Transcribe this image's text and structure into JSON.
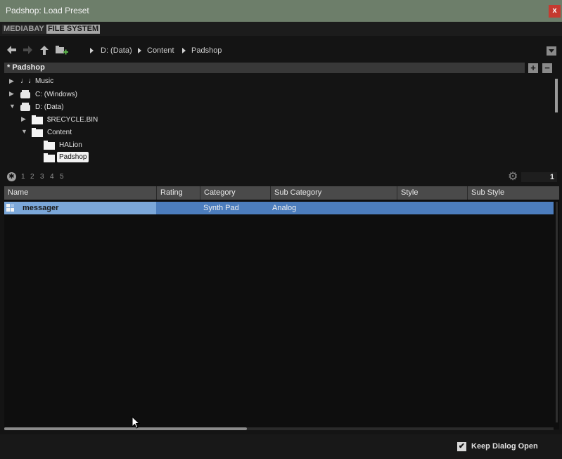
{
  "window": {
    "title": "Padshop: Load Preset",
    "close_label": "x"
  },
  "tabs": [
    {
      "label": "MEDIABAY",
      "active": false
    },
    {
      "label": "FILE SYSTEM",
      "active": true
    }
  ],
  "nav": {
    "back_icon": "arrow-left-icon",
    "forward_icon": "arrow-right-icon",
    "up_icon": "arrow-up-icon",
    "new_folder_icon": "new-folder-icon",
    "breadcrumbs": [
      "D: (Data)",
      "Content",
      "Padshop"
    ]
  },
  "favorites": {
    "label": "Padshop",
    "star": "*",
    "add_label": "+",
    "remove_label": "−"
  },
  "tree": [
    {
      "label": "Music",
      "expanded": false,
      "icon": "music-icon"
    },
    {
      "label": "C: (Windows)",
      "expanded": false,
      "icon": "drive-icon"
    },
    {
      "label": "D: (Data)",
      "expanded": true,
      "icon": "drive-icon"
    },
    {
      "label": "$RECYCLE.BIN",
      "expanded": false,
      "icon": "folder-icon"
    },
    {
      "label": "Content",
      "expanded": true,
      "icon": "folder-icon"
    },
    {
      "label": "HALion",
      "expanded": false,
      "icon": "folder-icon"
    },
    {
      "label": "Padshop",
      "expanded": false,
      "icon": "folder-icon",
      "selected": true
    }
  ],
  "filter": {
    "ratings": [
      "1",
      "2",
      "3",
      "4",
      "5"
    ],
    "result_count": "1"
  },
  "table": {
    "columns": [
      "Name",
      "Rating",
      "Category",
      "Sub Category",
      "Style",
      "Sub Style"
    ],
    "rows": [
      {
        "name": "messager",
        "rating": "",
        "category": "Synth Pad",
        "sub_category": "Analog",
        "style": "",
        "sub_style": ""
      }
    ]
  },
  "footer": {
    "keep_open_label": "Keep Dialog Open",
    "keep_open_checked": true
  },
  "colors": {
    "titlebar": "#6d7e6a",
    "selection": "#4c7dbd",
    "close": "#c63a2f"
  }
}
